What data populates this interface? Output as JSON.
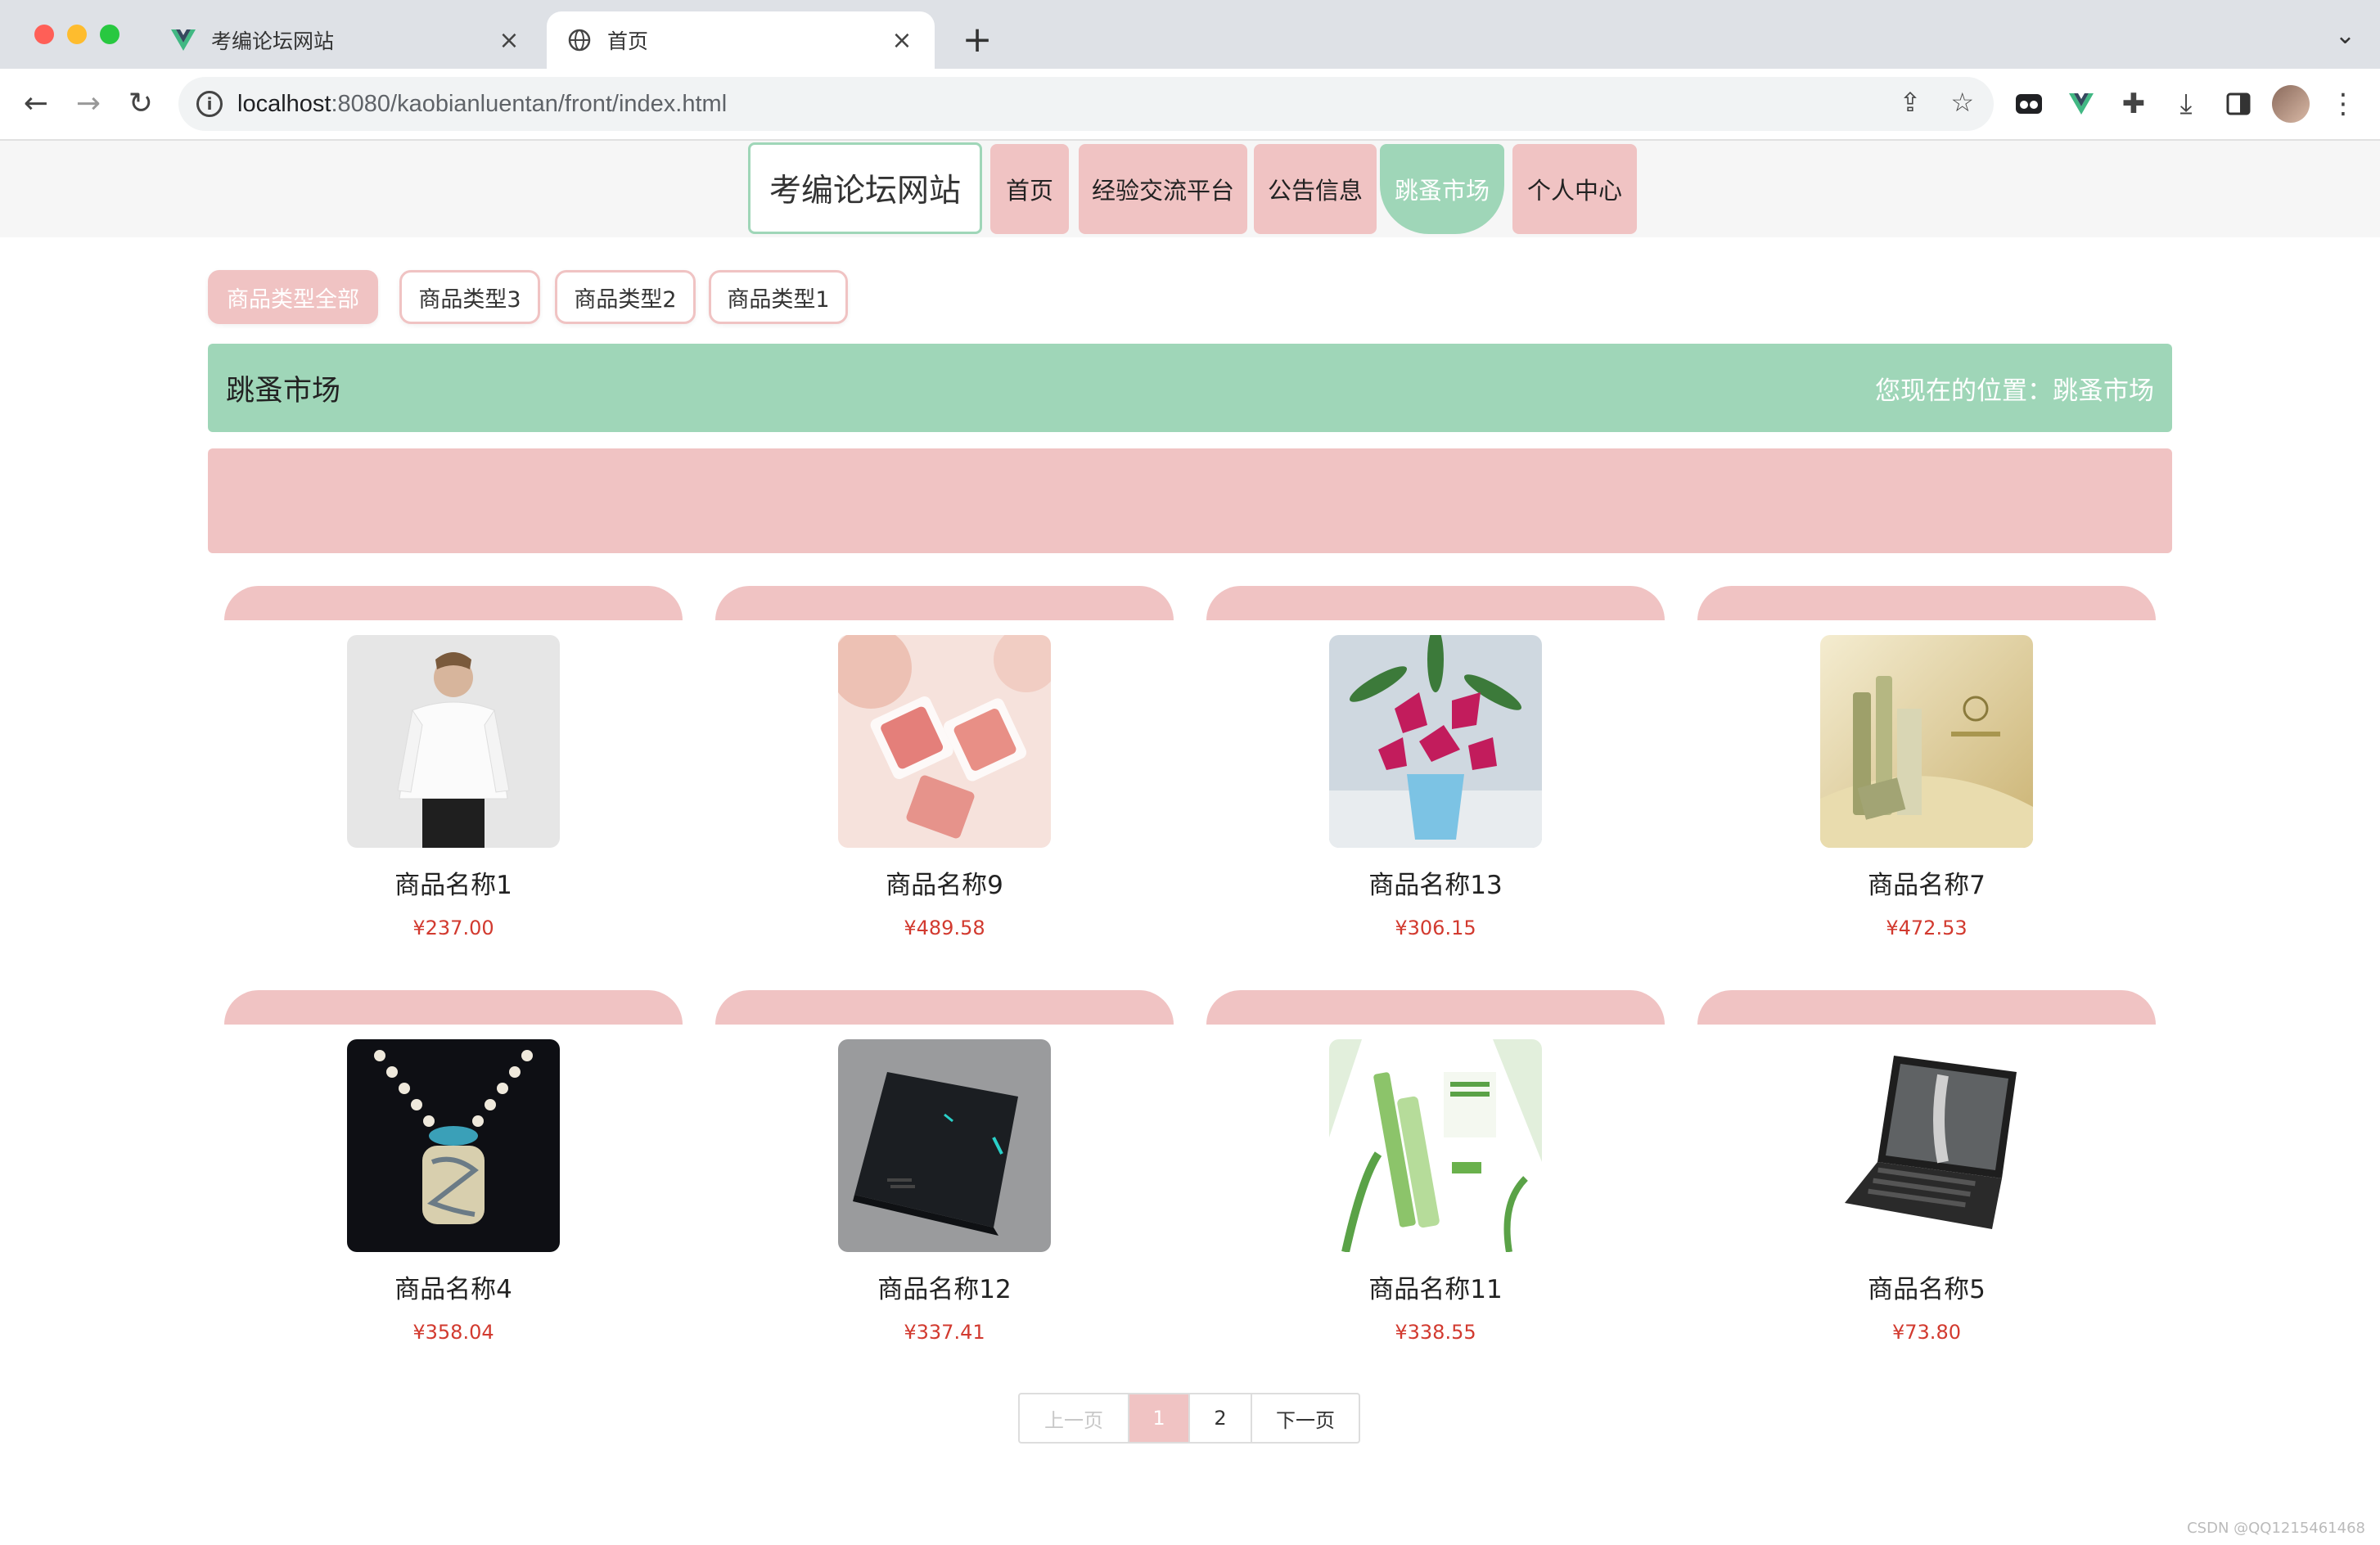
{
  "browser": {
    "tabs": [
      {
        "title": "考编论坛网站",
        "active": false
      },
      {
        "title": "首页",
        "active": true
      }
    ],
    "url_host": "localhost",
    "url_path": ":8080/kaobianluentan/front/index.html"
  },
  "site": {
    "logo": "考编论坛网站",
    "nav": [
      {
        "label": "首页"
      },
      {
        "label": "经验交流平台"
      },
      {
        "label": "公告信息"
      },
      {
        "label": "跳蚤市场",
        "active": true
      },
      {
        "label": "个人中心"
      }
    ]
  },
  "categories": [
    {
      "label": "商品类型全部",
      "active": true
    },
    {
      "label": "商品类型3"
    },
    {
      "label": "商品类型2"
    },
    {
      "label": "商品类型1"
    }
  ],
  "header": {
    "title": "跳蚤市场",
    "breadcrumb": "您现在的位置：跳蚤市场"
  },
  "products": [
    {
      "name": "商品名称1",
      "price": "¥237.00",
      "icon": "shirt-photo"
    },
    {
      "name": "商品名称9",
      "price": "¥489.58",
      "icon": "blush-photo"
    },
    {
      "name": "商品名称13",
      "price": "¥306.15",
      "icon": "lily-photo"
    },
    {
      "name": "商品名称7",
      "price": "¥472.53",
      "icon": "cosmetics-photo"
    },
    {
      "name": "商品名称4",
      "price": "¥358.04",
      "icon": "necklace-photo"
    },
    {
      "name": "商品名称12",
      "price": "¥337.41",
      "icon": "laptop-closed-photo"
    },
    {
      "name": "商品名称11",
      "price": "¥338.55",
      "icon": "skincare-photo"
    },
    {
      "name": "商品名称5",
      "price": "¥73.80",
      "icon": "laptop-open-photo"
    }
  ],
  "pagination": {
    "prev": "上一页",
    "pages": [
      "1",
      "2"
    ],
    "current": "1",
    "next": "下一页"
  },
  "watermark": "CSDN @QQ1215461468",
  "colors": {
    "pink": "#f0c3c3",
    "green": "#9fd6b8",
    "price": "#d23a2f"
  }
}
